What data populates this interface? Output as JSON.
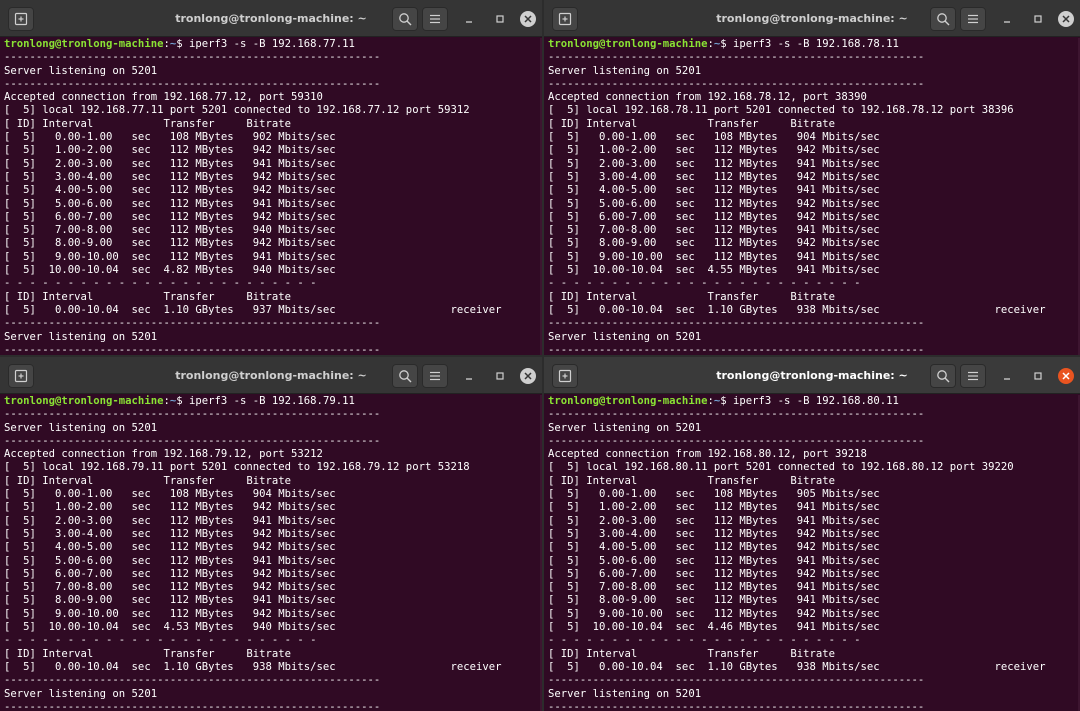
{
  "colors": {
    "terminal_bg": "#300a24",
    "titlebar_bg": "#353535",
    "prompt_user": "#8ae234",
    "prompt_path": "#729fcf",
    "close_active": "#e95420"
  },
  "terminals": [
    {
      "title": "tronlong@tronlong-machine: ~",
      "active": false,
      "prompt": {
        "user": "tronlong@tronlong-machine",
        "path": "~",
        "symbol": "$",
        "command": " iperf3 -s -B 192.168.77.11"
      },
      "lines": [
        "-----------------------------------------------------------",
        "Server listening on 5201",
        "-----------------------------------------------------------",
        "Accepted connection from 192.168.77.12, port 59310",
        "[  5] local 192.168.77.11 port 5201 connected to 192.168.77.12 port 59312",
        "[ ID] Interval           Transfer     Bitrate",
        "[  5]   0.00-1.00   sec   108 MBytes   902 Mbits/sec",
        "[  5]   1.00-2.00   sec   112 MBytes   942 Mbits/sec",
        "[  5]   2.00-3.00   sec   112 MBytes   941 Mbits/sec",
        "[  5]   3.00-4.00   sec   112 MBytes   942 Mbits/sec",
        "[  5]   4.00-5.00   sec   112 MBytes   942 Mbits/sec",
        "[  5]   5.00-6.00   sec   112 MBytes   941 Mbits/sec",
        "[  5]   6.00-7.00   sec   112 MBytes   942 Mbits/sec",
        "[  5]   7.00-8.00   sec   112 MBytes   940 Mbits/sec",
        "[  5]   8.00-9.00   sec   112 MBytes   942 Mbits/sec",
        "[  5]   9.00-10.00  sec   112 MBytes   941 Mbits/sec",
        "[  5]  10.00-10.04  sec  4.82 MBytes   940 Mbits/sec",
        "- - - - - - - - - - - - - - - - - - - - - - - - -",
        "[ ID] Interval           Transfer     Bitrate",
        "[  5]   0.00-10.04  sec  1.10 GBytes   937 Mbits/sec                  receiver",
        "-----------------------------------------------------------",
        "Server listening on 5201",
        "-----------------------------------------------------------"
      ]
    },
    {
      "title": "tronlong@tronlong-machine: ~",
      "active": false,
      "prompt": {
        "user": "tronlong@tronlong-machine",
        "path": "~",
        "symbol": "$",
        "command": " iperf3 -s -B 192.168.78.11"
      },
      "lines": [
        "-----------------------------------------------------------",
        "Server listening on 5201",
        "-----------------------------------------------------------",
        "Accepted connection from 192.168.78.12, port 38390",
        "[  5] local 192.168.78.11 port 5201 connected to 192.168.78.12 port 38396",
        "[ ID] Interval           Transfer     Bitrate",
        "[  5]   0.00-1.00   sec   108 MBytes   904 Mbits/sec",
        "[  5]   1.00-2.00   sec   112 MBytes   942 Mbits/sec",
        "[  5]   2.00-3.00   sec   112 MBytes   941 Mbits/sec",
        "[  5]   3.00-4.00   sec   112 MBytes   942 Mbits/sec",
        "[  5]   4.00-5.00   sec   112 MBytes   941 Mbits/sec",
        "[  5]   5.00-6.00   sec   112 MBytes   942 Mbits/sec",
        "[  5]   6.00-7.00   sec   112 MBytes   942 Mbits/sec",
        "[  5]   7.00-8.00   sec   112 MBytes   941 Mbits/sec",
        "[  5]   8.00-9.00   sec   112 MBytes   942 Mbits/sec",
        "[  5]   9.00-10.00  sec   112 MBytes   941 Mbits/sec",
        "[  5]  10.00-10.04  sec  4.55 MBytes   941 Mbits/sec",
        "- - - - - - - - - - - - - - - - - - - - - - - - -",
        "[ ID] Interval           Transfer     Bitrate",
        "[  5]   0.00-10.04  sec  1.10 GBytes   938 Mbits/sec                  receiver",
        "-----------------------------------------------------------",
        "Server listening on 5201",
        "-----------------------------------------------------------"
      ]
    },
    {
      "title": "tronlong@tronlong-machine: ~",
      "active": false,
      "prompt": {
        "user": "tronlong@tronlong-machine",
        "path": "~",
        "symbol": "$",
        "command": " iperf3 -s -B 192.168.79.11"
      },
      "lines": [
        "-----------------------------------------------------------",
        "Server listening on 5201",
        "-----------------------------------------------------------",
        "Accepted connection from 192.168.79.12, port 53212",
        "[  5] local 192.168.79.11 port 5201 connected to 192.168.79.12 port 53218",
        "[ ID] Interval           Transfer     Bitrate",
        "[  5]   0.00-1.00   sec   108 MBytes   904 Mbits/sec",
        "[  5]   1.00-2.00   sec   112 MBytes   942 Mbits/sec",
        "[  5]   2.00-3.00   sec   112 MBytes   941 Mbits/sec",
        "[  5]   3.00-4.00   sec   112 MBytes   942 Mbits/sec",
        "[  5]   4.00-5.00   sec   112 MBytes   942 Mbits/sec",
        "[  5]   5.00-6.00   sec   112 MBytes   941 Mbits/sec",
        "[  5]   6.00-7.00   sec   112 MBytes   942 Mbits/sec",
        "[  5]   7.00-8.00   sec   112 MBytes   942 Mbits/sec",
        "[  5]   8.00-9.00   sec   112 MBytes   941 Mbits/sec",
        "[  5]   9.00-10.00  sec   112 MBytes   942 Mbits/sec",
        "[  5]  10.00-10.04  sec  4.53 MBytes   940 Mbits/sec",
        "- - - - - - - - - - - - - - - - - - - - - - - - -",
        "[ ID] Interval           Transfer     Bitrate",
        "[  5]   0.00-10.04  sec  1.10 GBytes   938 Mbits/sec                  receiver",
        "-----------------------------------------------------------",
        "Server listening on 5201",
        "-----------------------------------------------------------"
      ]
    },
    {
      "title": "tronlong@tronlong-machine: ~",
      "active": true,
      "prompt": {
        "user": "tronlong@tronlong-machine",
        "path": "~",
        "symbol": "$",
        "command": " iperf3 -s -B 192.168.80.11"
      },
      "lines": [
        "-----------------------------------------------------------",
        "Server listening on 5201",
        "-----------------------------------------------------------",
        "Accepted connection from 192.168.80.12, port 39218",
        "[  5] local 192.168.80.11 port 5201 connected to 192.168.80.12 port 39220",
        "[ ID] Interval           Transfer     Bitrate",
        "[  5]   0.00-1.00   sec   108 MBytes   905 Mbits/sec",
        "[  5]   1.00-2.00   sec   112 MBytes   941 Mbits/sec",
        "[  5]   2.00-3.00   sec   112 MBytes   941 Mbits/sec",
        "[  5]   3.00-4.00   sec   112 MBytes   942 Mbits/sec",
        "[  5]   4.00-5.00   sec   112 MBytes   942 Mbits/sec",
        "[  5]   5.00-6.00   sec   112 MBytes   941 Mbits/sec",
        "[  5]   6.00-7.00   sec   112 MBytes   942 Mbits/sec",
        "[  5]   7.00-8.00   sec   112 MBytes   941 Mbits/sec",
        "[  5]   8.00-9.00   sec   112 MBytes   941 Mbits/sec",
        "[  5]   9.00-10.00  sec   112 MBytes   942 Mbits/sec",
        "[  5]  10.00-10.04  sec  4.46 MBytes   941 Mbits/sec",
        "- - - - - - - - - - - - - - - - - - - - - - - - -",
        "[ ID] Interval           Transfer     Bitrate",
        "[  5]   0.00-10.04  sec  1.10 GBytes   938 Mbits/sec                  receiver",
        "-----------------------------------------------------------",
        "Server listening on 5201",
        "-----------------------------------------------------------"
      ]
    }
  ]
}
